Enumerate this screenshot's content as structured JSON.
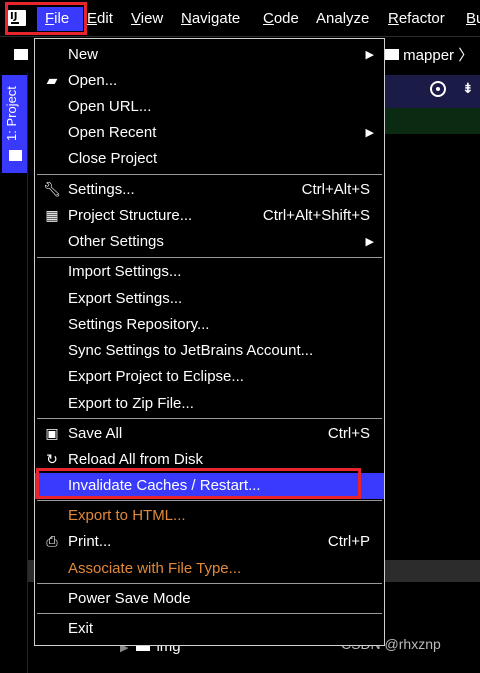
{
  "menubar": {
    "logo": "IJ",
    "items": [
      {
        "label": "File",
        "mnemonic": "F",
        "rest": "ile",
        "selected": true
      },
      {
        "label": "Edit",
        "mnemonic": "E",
        "rest": "dit"
      },
      {
        "label": "View",
        "mnemonic": "V",
        "rest": "iew"
      },
      {
        "label": "Navigate",
        "mnemonic": "N",
        "rest": "avigate"
      },
      {
        "label": "Code",
        "mnemonic": "C",
        "rest": "ode"
      },
      {
        "label": "Analyze",
        "mnemonic": "",
        "rest": "Analyze"
      },
      {
        "label": "Refactor",
        "mnemonic": "R",
        "rest": "efactor"
      },
      {
        "label": "Bu",
        "mnemonic": "B",
        "rest": "u"
      }
    ]
  },
  "breadcrumb": {
    "folder": "mapper",
    "separator": "〉"
  },
  "sidebar": {
    "project_tab": "1: Project"
  },
  "file_menu": {
    "items": [
      {
        "id": "new",
        "label": "New",
        "submenu": true
      },
      {
        "id": "open",
        "label": "Open...",
        "icon": "open-folder-icon"
      },
      {
        "id": "open-url",
        "label": "Open URL..."
      },
      {
        "id": "open-recent",
        "label": "Open Recent",
        "submenu": true
      },
      {
        "id": "close-project",
        "label": "Close Project"
      },
      {
        "id": "settings",
        "label": "Settings...",
        "shortcut": "Ctrl+Alt+S",
        "icon": "wrench-icon"
      },
      {
        "id": "project-structure",
        "label": "Project Structure...",
        "shortcut": "Ctrl+Alt+Shift+S",
        "icon": "project-structure-icon"
      },
      {
        "id": "other-settings",
        "label": "Other Settings",
        "submenu": true
      },
      {
        "id": "import-settings",
        "label": "Import Settings..."
      },
      {
        "id": "export-settings",
        "label": "Export Settings..."
      },
      {
        "id": "settings-repository",
        "label": "Settings Repository..."
      },
      {
        "id": "sync-settings",
        "label": "Sync Settings to JetBrains Account..."
      },
      {
        "id": "export-eclipse",
        "label": "Export Project to Eclipse..."
      },
      {
        "id": "export-zip",
        "label": "Export to Zip File..."
      },
      {
        "id": "save-all",
        "label": "Save All",
        "shortcut": "Ctrl+S",
        "icon": "save-icon"
      },
      {
        "id": "reload",
        "label": "Reload All from Disk",
        "icon": "reload-icon"
      },
      {
        "id": "invalidate-caches",
        "label": "Invalidate Caches / Restart...",
        "selected": true
      },
      {
        "id": "export-html",
        "label": "Export to HTML...",
        "disabled": true
      },
      {
        "id": "print",
        "label": "Print...",
        "shortcut": "Ctrl+P",
        "icon": "printer-icon"
      },
      {
        "id": "associate-file-type",
        "label": "Associate with File Type...",
        "disabled": true
      },
      {
        "id": "power-save",
        "label": "Power Save Mode"
      },
      {
        "id": "exit",
        "label": "Exit"
      }
    ]
  },
  "project_tree": {
    "visible_row": "img"
  },
  "watermark": "CSDN @rhxznp",
  "colors": {
    "selection": "#3a3aff",
    "highlight_box": "#e8252d",
    "disabled_text": "#e0893a"
  }
}
